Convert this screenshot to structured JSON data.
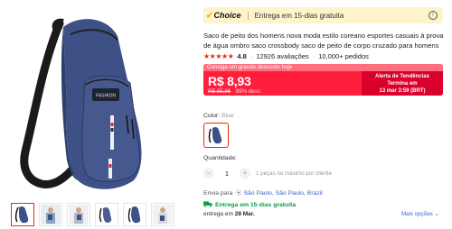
{
  "choice": {
    "badge": "Choice",
    "text": "Entrega em 15-dias gratuita",
    "info": "!"
  },
  "product": {
    "title": "Saco de peito dos homens nova moda estilo coreano esportes casuais à prova de água ombro saco crossbody saco de peito de corpo cruzado para homens",
    "stars": "★★★★★",
    "rating": "4.8",
    "reviews": "12926 avaliações",
    "orders": "10,000+ pedidos",
    "bag_label": "FASHION"
  },
  "promo": {
    "banner": "Consiga um grande desconto hoje",
    "price": "R$ 8,93",
    "old_price": "R$ 85,86",
    "discount": "89% desc.",
    "alert_line1": "Alerta de Tendências",
    "alert_line2": "Termina em",
    "alert_line3": "13 mar 3:59 (BRT)"
  },
  "color": {
    "label": "Color:",
    "value": "Blue"
  },
  "quantity": {
    "label": "Quantidade:",
    "value": "1",
    "minus": "−",
    "plus": "+",
    "note": "1 peças no máximo por cliente"
  },
  "shipping": {
    "label": "Envia para",
    "location": "São Paulo, São Paulo, Brazil",
    "delivery": "Entrega em 15-dias gratuita",
    "date_prefix": "entrega em",
    "date": "28 Mar.",
    "more_options": "Mais opções"
  },
  "colors": {
    "accent": "#e62e04",
    "promo_bg": "#ff1f3d",
    "choice_bg": "#fdf4cc",
    "delivery_green": "#00a34a",
    "link": "#3366cc",
    "bag_blue": "#3e5186"
  }
}
